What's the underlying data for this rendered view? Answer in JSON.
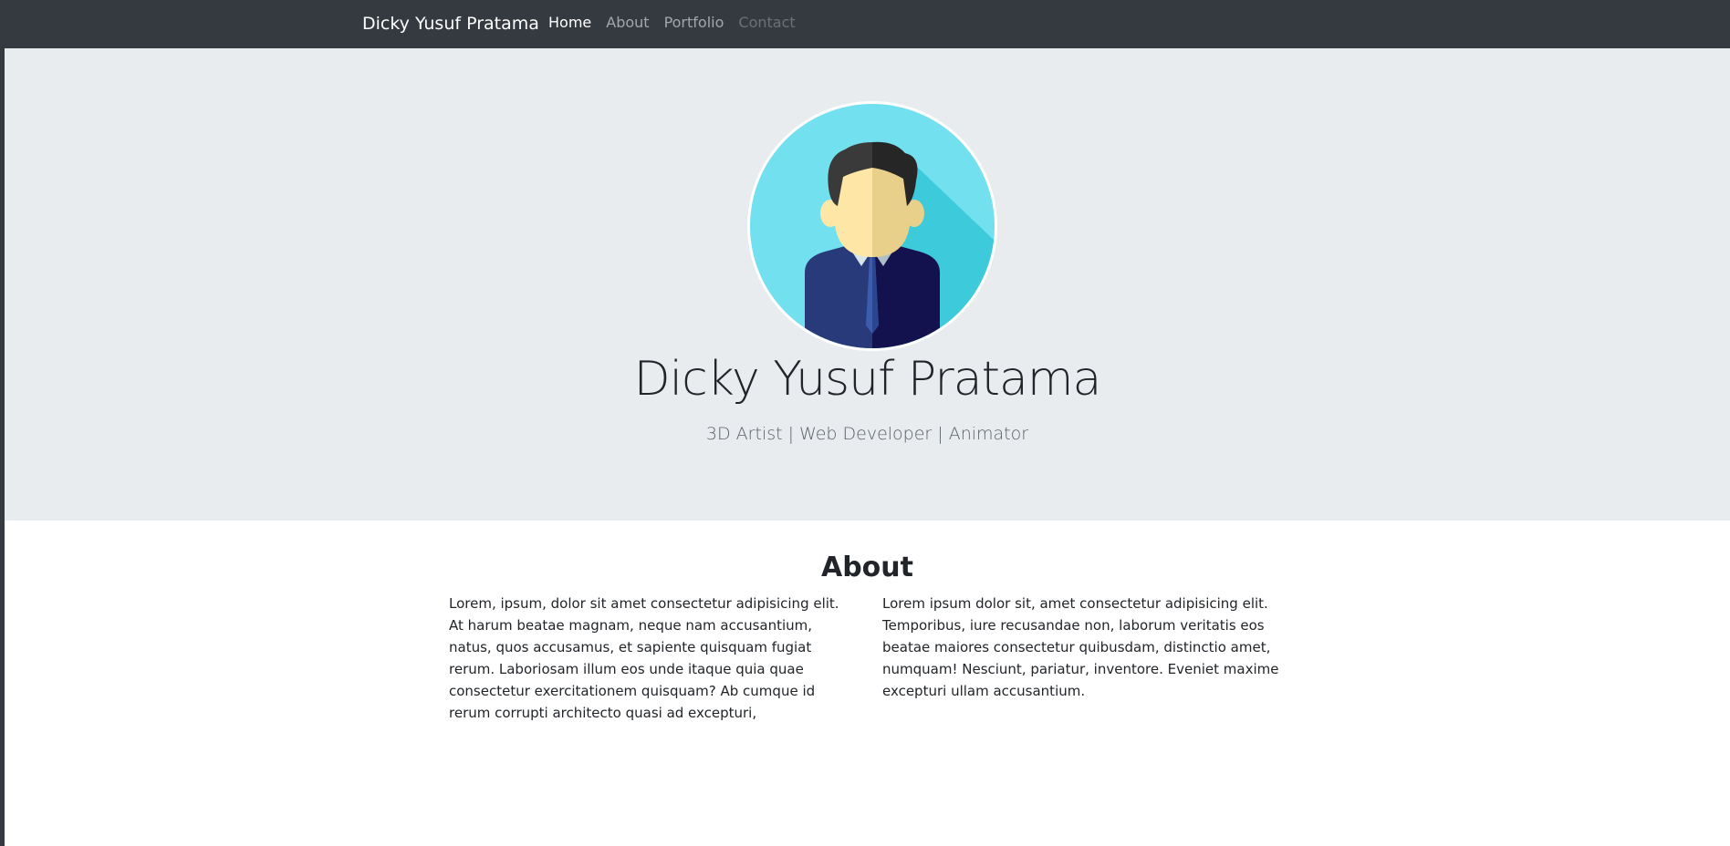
{
  "navbar": {
    "brand": "Dicky Yusuf Pratama",
    "links": [
      {
        "label": "Home",
        "state": "active"
      },
      {
        "label": "About",
        "state": "normal"
      },
      {
        "label": "Portfolio",
        "state": "normal"
      },
      {
        "label": "Contact",
        "state": "disabled"
      }
    ]
  },
  "hero": {
    "avatar_icon": "person-avatar-icon",
    "name": "Dicky Yusuf Pratama",
    "tagline": "3D Artist | Web Developer | Animator"
  },
  "about": {
    "title": "About",
    "paragraphs": [
      "Lorem, ipsum, dolor sit amet consectetur adipisicing elit. At harum beatae magnam, neque nam accusantium, natus, quos accusamus, et sapiente quisquam fugiat rerum. Laboriosam illum eos unde itaque quia quae consectetur exercitationem quisquam? Ab cumque id rerum corrupti architecto quasi ad excepturi,",
      "Lorem ipsum dolor sit, amet consectetur adipisicing elit. Temporibus, iure recusandae non, laborum veritatis eos beatae maiores consectetur quibusdam, distinctio amet, numquam! Nesciunt, pariatur, inventore. Eveniet maxime excepturi ullam accusantium."
    ]
  },
  "colors": {
    "navbar_bg": "#343a40",
    "hero_bg": "#e9ecef",
    "avatar_bg": "#72e0ef",
    "text": "#212529"
  }
}
